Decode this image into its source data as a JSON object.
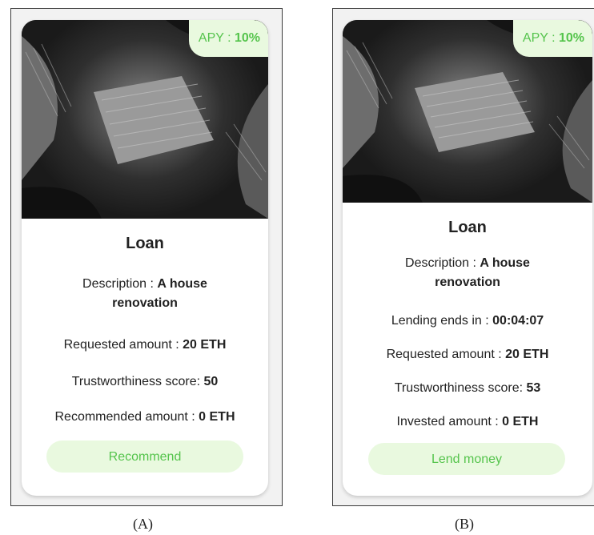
{
  "cards": [
    {
      "apy_label": "APY : ",
      "apy_value": "10%",
      "title": "Loan",
      "description_label": "Description : ",
      "description_value": "A house renovation",
      "requested_label": "Requested amount : ",
      "requested_value": "20 ETH",
      "trust_label": "Trustworthiness score: ",
      "trust_value": "50",
      "recommended_label": "Recommended amount : ",
      "recommended_value": "0 ETH",
      "button_label": "Recommend",
      "caption": "(A)"
    },
    {
      "apy_label": "APY : ",
      "apy_value": "10%",
      "title": "Loan",
      "description_label": "Description : ",
      "description_value": "A house renovation",
      "lending_label": "Lending ends in : ",
      "lending_value": "00:04:07",
      "requested_label": "Requested amount : ",
      "requested_value": "20 ETH",
      "trust_label": "Trustworthiness score: ",
      "trust_value": "53",
      "invested_label": "Invested amount : ",
      "invested_value": "0 ETH",
      "button_label": "Lend money",
      "caption": "(B)"
    }
  ],
  "colors": {
    "accent": "#55c44c",
    "accent_bg": "#e9f9df",
    "text": "#222222"
  }
}
